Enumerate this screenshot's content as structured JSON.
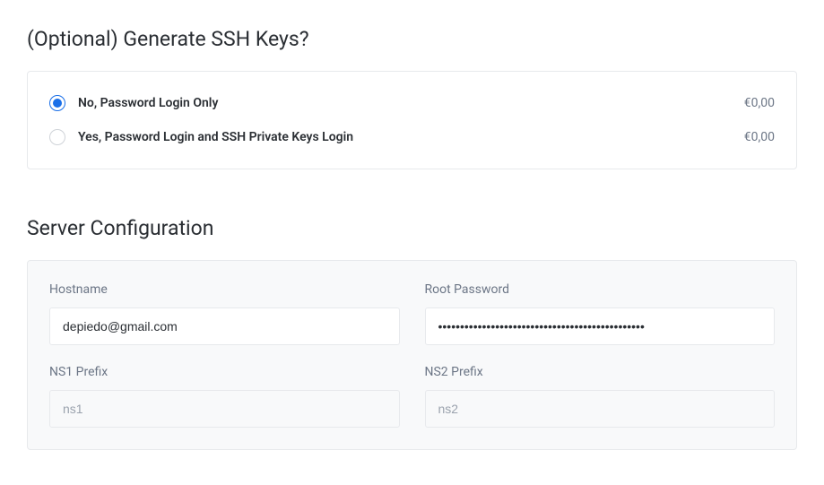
{
  "ssh": {
    "title": "(Optional) Generate SSH Keys?",
    "options": [
      {
        "label": "No, Password Login Only",
        "price": "€0,00",
        "checked": true
      },
      {
        "label": "Yes, Password Login and SSH Private Keys Login",
        "price": "€0,00",
        "checked": false
      }
    ]
  },
  "config": {
    "title": "Server Configuration",
    "fields": {
      "hostname": {
        "label": "Hostname",
        "value": "depiedo@gmail.com",
        "placeholder": ""
      },
      "root_pw": {
        "label": "Root Password",
        "value": "•••••••••••••••••••••••••••••••••••••••••••••••",
        "placeholder": ""
      },
      "ns1": {
        "label": "NS1 Prefix",
        "value": "",
        "placeholder": "ns1"
      },
      "ns2": {
        "label": "NS2 Prefix",
        "value": "",
        "placeholder": "ns2"
      }
    }
  }
}
